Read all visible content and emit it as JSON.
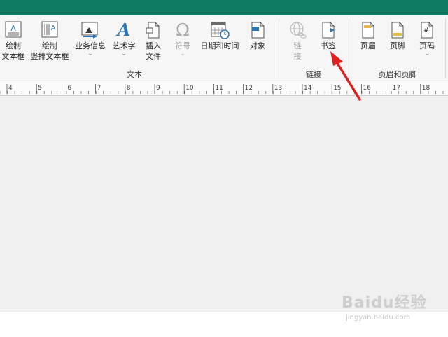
{
  "ribbon": {
    "groups": {
      "text": {
        "label": "文本"
      },
      "links": {
        "label": "链接"
      },
      "header_footer": {
        "label": "页眉和页脚"
      }
    },
    "buttons": {
      "draw_textbox": {
        "line1": "绘制",
        "line2": "文本框"
      },
      "draw_vertical_textbox": {
        "line1": "绘制",
        "line2": "竖排文本框"
      },
      "business_info": {
        "line1": "业务信息",
        "caret": "⌄"
      },
      "wordart": {
        "line1": "艺术字",
        "caret": "⌄"
      },
      "insert_file": {
        "line1": "插入",
        "line2": "文件"
      },
      "symbol": {
        "line1": "符号",
        "caret": "⌄",
        "icon_glyph": "Ω"
      },
      "date_time": {
        "line1": "日期和时间"
      },
      "object": {
        "line1": "对象"
      },
      "hyperlink": {
        "line1": "链",
        "line2": "接"
      },
      "bookmark": {
        "line1": "书签"
      },
      "header": {
        "line1": "页眉"
      },
      "footer": {
        "line1": "页脚"
      },
      "page_number": {
        "line1": "页码",
        "caret": "⌄",
        "icon_glyph": "#"
      }
    }
  },
  "ruler": {
    "numbers": [
      "4",
      "5",
      "6",
      "7",
      "8",
      "9",
      "10",
      "11",
      "12",
      "13",
      "14",
      "15",
      "16",
      "17",
      "18"
    ]
  },
  "watermark": {
    "logo": "Baidu经验",
    "url": "jingyan.baidu.com"
  },
  "colors": {
    "titlebar": "#0f7b63",
    "arrow": "#e01f1f",
    "accent_blue": "#2e75b6"
  }
}
